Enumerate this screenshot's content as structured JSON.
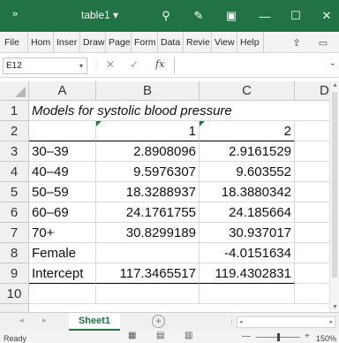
{
  "titlebar": {
    "qat": "»",
    "doc_title": "table1 ▾",
    "icons": [
      "search-icon",
      "pen-icon",
      "ribbon-display-icon",
      "minimize-icon",
      "restore-icon",
      "close-icon"
    ],
    "search_glyph": "⚲",
    "pen_glyph": "✎",
    "ribbon_glyph": "▣",
    "minimize_glyph": "—",
    "restore_glyph": "☐",
    "close_glyph": "✕"
  },
  "ribbon": {
    "tabs": [
      "File",
      "Hom",
      "Inser",
      "Draw",
      "Page",
      "Form",
      "Data",
      "Revie",
      "View",
      "Help"
    ],
    "share_glyph": "⇪",
    "comments_glyph": "▭"
  },
  "formula_bar": {
    "name_box": "E12",
    "name_caret": "▾",
    "sep": "⋮",
    "cancel_glyph": "✕",
    "enter_glyph": "✓",
    "fx_label": "fx",
    "value": "",
    "expand_caret": "⌄"
  },
  "columns": [
    "A",
    "B",
    "C",
    "D"
  ],
  "rows": [
    {
      "num": "1",
      "a": "Models for systolic blood pressure",
      "b": "",
      "c": ""
    },
    {
      "num": "2",
      "a": "",
      "b": "1",
      "c": "2"
    },
    {
      "num": "3",
      "a": "30–39",
      "b": "2.8908096",
      "c": "2.9161529"
    },
    {
      "num": "4",
      "a": "40–49",
      "b": "9.5976307",
      "c": "9.603552"
    },
    {
      "num": "5",
      "a": "50–59",
      "b": "18.3288937",
      "c": "18.3880342"
    },
    {
      "num": "6",
      "a": "60–69",
      "b": "24.1761755",
      "c": "24.185664"
    },
    {
      "num": "7",
      "a": "70+",
      "b": "30.8299189",
      "c": "30.937017"
    },
    {
      "num": "8",
      "a": "Female",
      "b": "",
      "c": "-4.0151634"
    },
    {
      "num": "9",
      "a": "Intercept",
      "b": "117.3465517",
      "c": "119.4302831"
    },
    {
      "num": "10",
      "a": "",
      "b": "",
      "c": ""
    }
  ],
  "sheets": {
    "nav_prev": "◂",
    "nav_next": "▸",
    "active": "Sheet1",
    "add_glyph": "+",
    "scroll_sep": "⋮",
    "scroll_left": "◂",
    "scroll_right": "▸"
  },
  "status": {
    "text": "Ready",
    "view_normal": "▦",
    "view_layout": "▤",
    "view_break": "▥",
    "zoom_minus": "—",
    "zoom_plus": "+",
    "zoom": "150%"
  },
  "colors": {
    "excel_green": "#217346",
    "error_indicator": "#1e7d32"
  }
}
